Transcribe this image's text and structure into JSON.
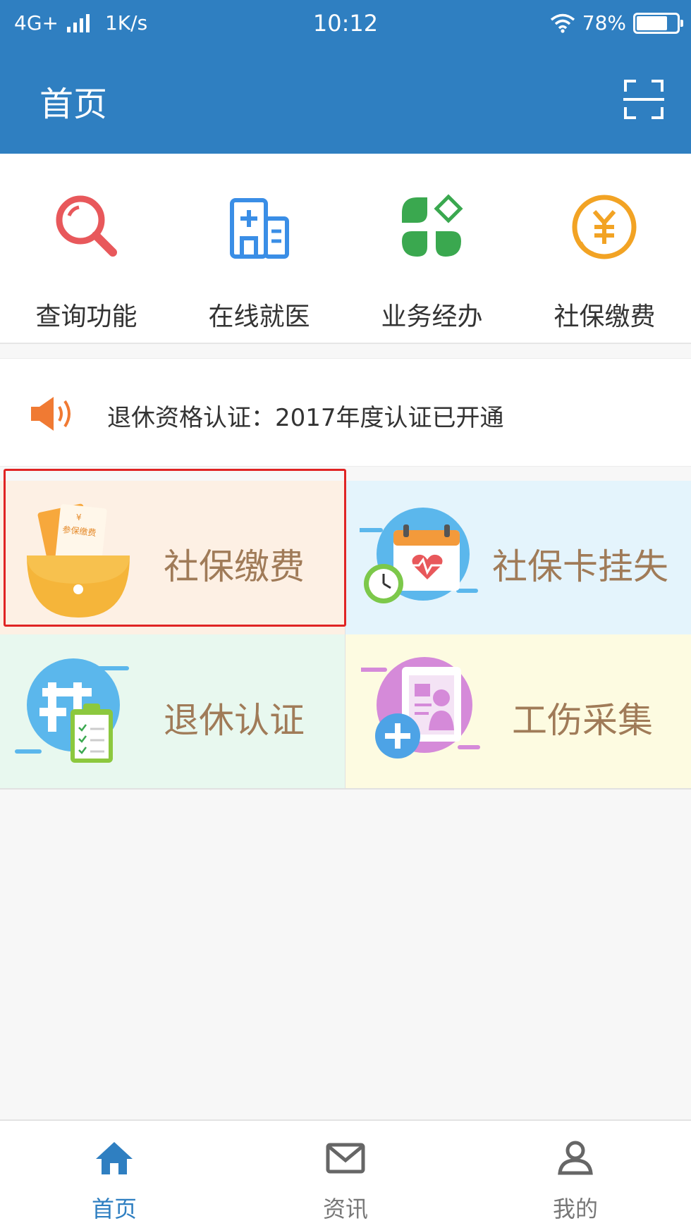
{
  "status_bar": {
    "network": "4G+",
    "speed": "1K/s",
    "time": "10:12",
    "battery": "78%",
    "battery_level": 0.78
  },
  "header": {
    "title": "首页"
  },
  "quick_menu": [
    {
      "label": "查询功能",
      "icon": "search-icon"
    },
    {
      "label": "在线就医",
      "icon": "hospital-icon"
    },
    {
      "label": "业务经办",
      "icon": "clover-icon"
    },
    {
      "label": "社保缴费",
      "icon": "yen-coin-icon"
    }
  ],
  "notice": {
    "text": "退休资格认证：2017年度认证已开通",
    "icon": "speaker-icon"
  },
  "tiles": [
    {
      "label": "社保缴费",
      "icon": "wallet-icon",
      "badge_text": "参保缴费",
      "bg": "#fdf0e4"
    },
    {
      "label": "社保卡挂失",
      "icon": "calendar-clock-icon",
      "bg": "#e4f4fc"
    },
    {
      "label": "退休认证",
      "icon": "clipboard-icon",
      "bg": "#e8f8ef"
    },
    {
      "label": "工伤采集",
      "icon": "medical-record-icon",
      "bg": "#fdfbe1"
    }
  ],
  "bottom_nav": [
    {
      "label": "首页",
      "icon": "home-icon",
      "active": true
    },
    {
      "label": "资讯",
      "icon": "mail-icon",
      "active": false
    },
    {
      "label": "我的",
      "icon": "user-icon",
      "active": false
    }
  ],
  "colors": {
    "primary": "#2f7fc1",
    "highlight": "#e02424",
    "tile_text": "#a07b58"
  }
}
